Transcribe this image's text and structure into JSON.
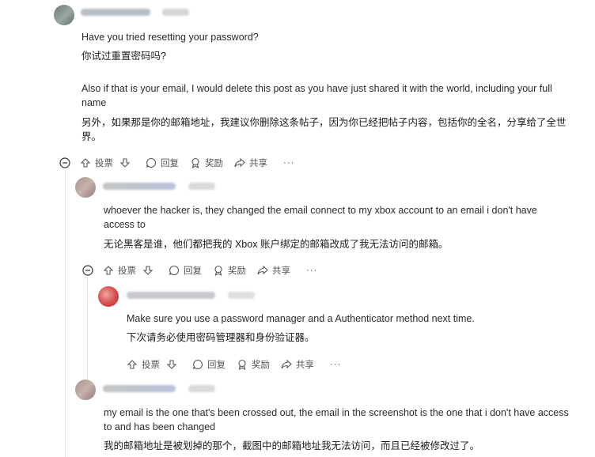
{
  "comments": [
    {
      "en": "Have you tried resetting your password?",
      "zh": "你试过重置密码吗?",
      "en2": "Also if that is your email, I would delete this post as you have just shared it with the world, including your full name",
      "zh2": "另外，如果那是你的邮箱地址，我建议你删除这条帖子，因为你已经把帖子内容，包括你的全名，分享给了全世界。"
    },
    {
      "en": "whoever the hacker is, they changed the email connect to my xbox account to an email i don't have access to",
      "zh": "无论黑客是谁，他们都把我的 Xbox 账户绑定的邮箱改成了我无法访问的邮箱。"
    },
    {
      "en": "Make sure you use a password manager and a Authenticator method next time.",
      "zh": "下次请务必使用密码管理器和身份验证器。"
    },
    {
      "en": "my email is the one that's been crossed out, the email in the screenshot is the one that i don't have access to and has been changed",
      "zh": "我的邮箱地址是被划掉的那个，截图中的邮箱地址我无法访问，而且已经被修改过了。"
    }
  ],
  "actions": {
    "upvote": "投票",
    "reply": "回复",
    "award": "奖励",
    "share": "共享",
    "more": "···"
  },
  "colors": {
    "text": "#1c1c1c",
    "muted": "#555555",
    "thread": "#e6e6e6"
  }
}
